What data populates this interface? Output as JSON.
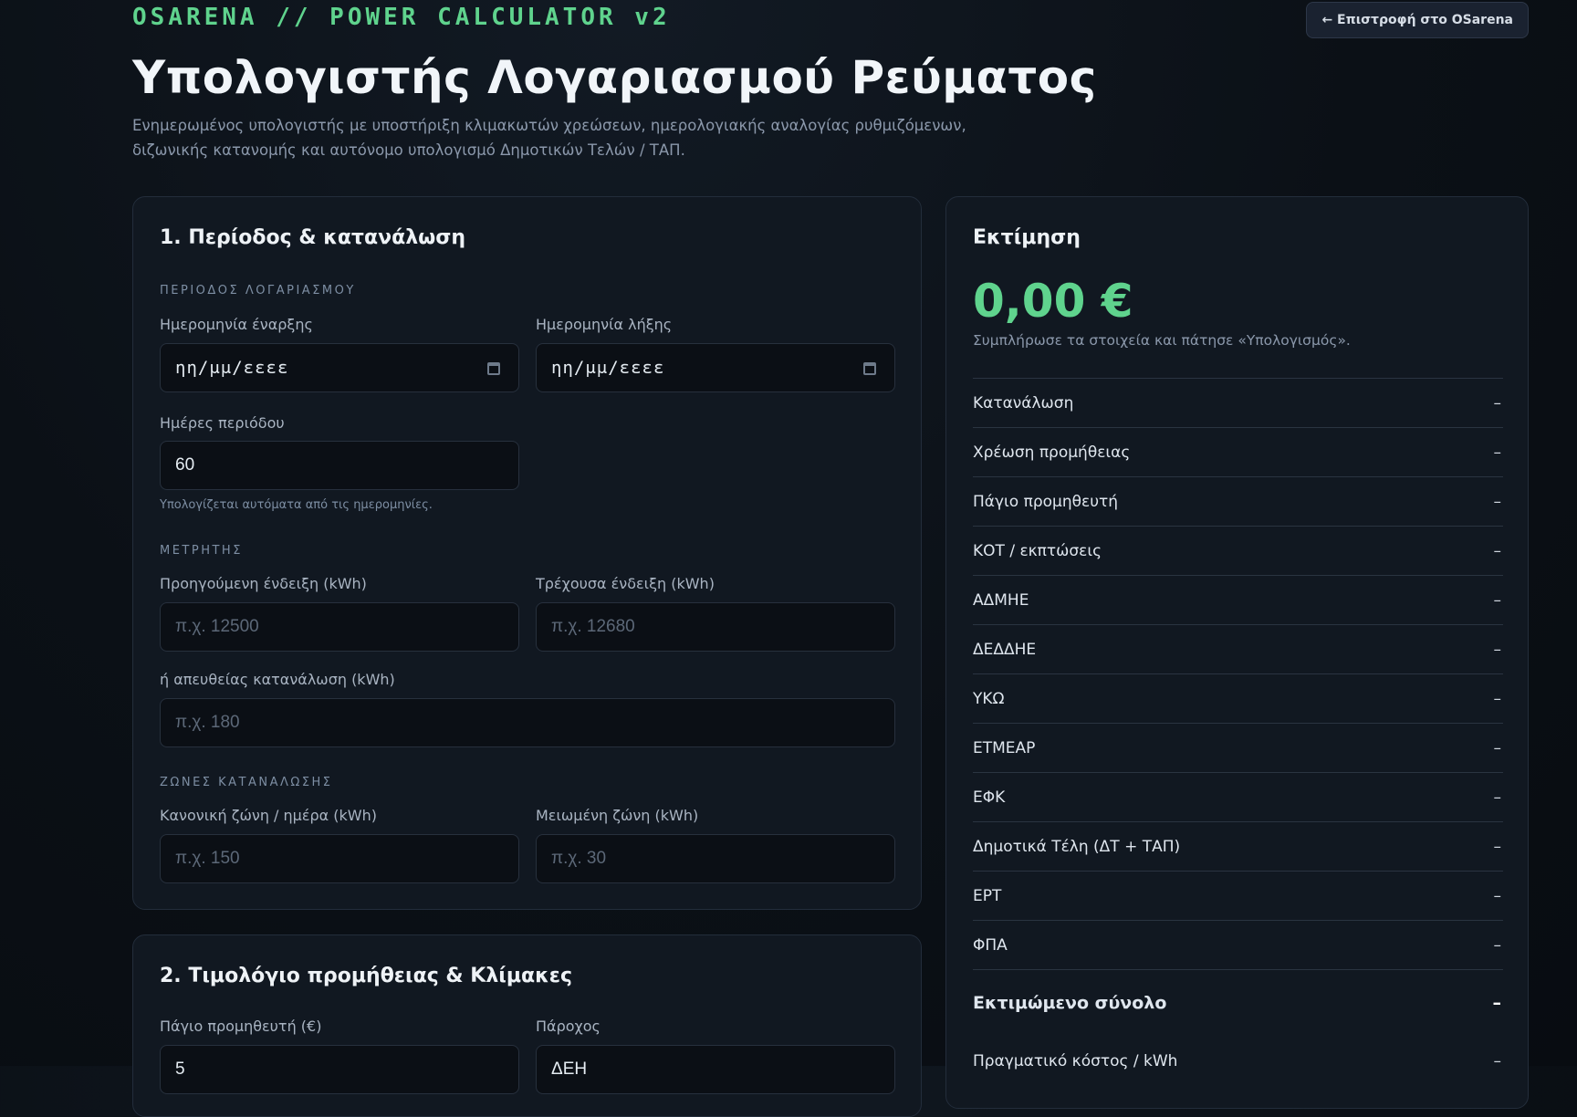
{
  "header": {
    "brand": "OSARENA // POWER CALCULATOR v2",
    "back_button": "← Επιστροφή στο OSarena",
    "title": "Υπολογιστής Λογαριασμού Ρεύματος",
    "subtitle": "Ενημερωμένος υπολογιστής με υποστήριξη κλιμακωτών χρεώσεων, ημερολογιακής αναλογίας ρυθμιζόμενων, διζωνικής κατανομής και αυτόνομο υπολογισμό Δημοτικών Τελών / ΤΑΠ."
  },
  "section1": {
    "heading": "1. Περίοδος & κατανάλωση",
    "period_label": "ΠΕΡΙΟΔΟΣ ΛΟΓΑΡΙΑΣΜΟΥ",
    "start_date_label": "Ημερομηνία έναρξης",
    "start_date_value": "ηη/μμ/εεεε",
    "end_date_label": "Ημερομηνία λήξης",
    "end_date_value": "ηη/μμ/εεεε",
    "days_label": "Ημέρες περιόδου",
    "days_value": "60",
    "days_hint": "Υπολογίζεται αυτόματα από τις ημερομηνίες.",
    "meter_label": "ΜΕΤΡΗΤΗΣ",
    "prev_reading_label": "Προηγούμενη ένδειξη (kWh)",
    "prev_reading_placeholder": "π.χ. 12500",
    "curr_reading_label": "Τρέχουσα ένδειξη (kWh)",
    "curr_reading_placeholder": "π.χ. 12680",
    "direct_label": "ή απευθείας κατανάλωση (kWh)",
    "direct_placeholder": "π.χ. 180",
    "zones_label": "ΖΩΝΕΣ ΚΑΤΑΝΑΛΩΣΗΣ",
    "normal_zone_label": "Κανονική ζώνη / ημέρα (kWh)",
    "normal_zone_placeholder": "π.χ. 150",
    "reduced_zone_label": "Μειωμένη ζώνη (kWh)",
    "reduced_zone_placeholder": "π.χ. 30"
  },
  "section2": {
    "heading": "2. Τιμολόγιο προμήθειας & Κλίμακες",
    "fixed_label": "Πάγιο προμηθευτή (€)",
    "fixed_value": "5",
    "provider_label": "Πάροχος",
    "provider_value": "ΔΕΗ"
  },
  "estimate": {
    "heading": "Εκτίμηση",
    "amount": "0,00 €",
    "note": "Συμπλήρωσε τα στοιχεία και πάτησε «Υπολογισμός».",
    "rows": [
      {
        "label": "Κατανάλωση",
        "value": "–"
      },
      {
        "label": "Χρέωση προμήθειας",
        "value": "–"
      },
      {
        "label": "Πάγιο προμηθευτή",
        "value": "–"
      },
      {
        "label": "ΚΟΤ / εκπτώσεις",
        "value": "–"
      },
      {
        "label": "ΑΔΜΗΕ",
        "value": "–"
      },
      {
        "label": "ΔΕΔΔΗΕ",
        "value": "–"
      },
      {
        "label": "ΥΚΩ",
        "value": "–"
      },
      {
        "label": "ΕΤΜΕΑΡ",
        "value": "–"
      },
      {
        "label": "ΕΦΚ",
        "value": "–"
      },
      {
        "label": "Δημοτικά Τέλη (ΔΤ + ΤΑΠ)",
        "value": "–"
      },
      {
        "label": "ΕΡΤ",
        "value": "–"
      },
      {
        "label": "ΦΠΑ",
        "value": "–"
      }
    ],
    "total_label": "Εκτιμώμενο σύνολο",
    "total_value": "–",
    "per_kwh_label": "Πραγματικό κόστος / kWh",
    "per_kwh_value": "–"
  },
  "colors": {
    "accent": "#5fd38d",
    "background": "#0b1016",
    "card": "#111821"
  }
}
